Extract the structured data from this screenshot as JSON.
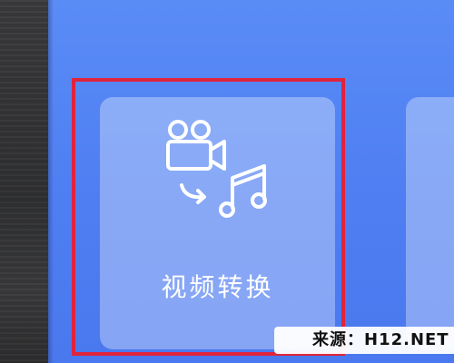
{
  "card": {
    "label": "视频转换",
    "icon": "video-to-audio-icon"
  },
  "watermark": {
    "text": "来源：H12.NET"
  },
  "colors": {
    "background": "#5a8cf6",
    "highlight": "#e0243d",
    "card": "rgba(255,255,255,0.33)"
  }
}
